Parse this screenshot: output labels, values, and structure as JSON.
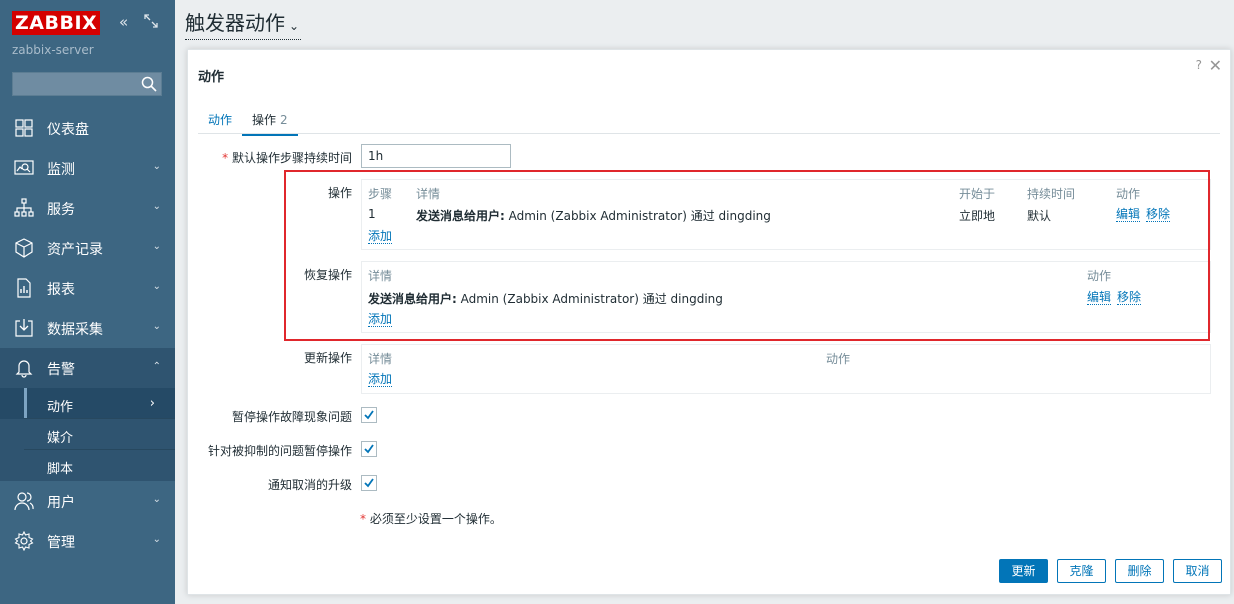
{
  "sidebar": {
    "logo": "ZABBIX",
    "server": "zabbix-server",
    "search_placeholder": "",
    "items": [
      {
        "label": "仪表盘",
        "icon": "dashboard-icon",
        "chevron": ""
      },
      {
        "label": "监测",
        "icon": "monitoring-icon",
        "chevron": "⌄"
      },
      {
        "label": "服务",
        "icon": "services-icon",
        "chevron": "⌄"
      },
      {
        "label": "资产记录",
        "icon": "inventory-icon",
        "chevron": "⌄"
      },
      {
        "label": "报表",
        "icon": "reports-icon",
        "chevron": "⌄"
      },
      {
        "label": "数据采集",
        "icon": "data-collection-icon",
        "chevron": "⌄"
      },
      {
        "label": "告警",
        "icon": "alerts-icon",
        "chevron": "⌃"
      },
      {
        "label": "用户",
        "icon": "users-icon",
        "chevron": "⌄"
      },
      {
        "label": "管理",
        "icon": "administration-icon",
        "chevron": "⌄"
      }
    ],
    "alerts_submenu": [
      {
        "label": "动作",
        "chevron": "›"
      },
      {
        "label": "媒介"
      },
      {
        "label": "脚本"
      }
    ]
  },
  "header": {
    "title": "触发器动作",
    "dropdown_glyph": "⌄"
  },
  "modal": {
    "title": "动作",
    "help": "?",
    "close": "✕",
    "tabs": [
      {
        "label": "动作"
      },
      {
        "label": "操作",
        "count": "2"
      }
    ],
    "default_duration": {
      "required_mark": "*",
      "label": "默认操作步骤持续时间",
      "value": "1h"
    },
    "operations": {
      "label": "操作",
      "headers": {
        "step": "步骤",
        "details": "详情",
        "start": "开始于",
        "duration": "持续时间",
        "action": "动作"
      },
      "rows": [
        {
          "step": "1",
          "details_bold": "发送消息给用户:",
          "details_rest": " Admin (Zabbix Administrator) 通过 dingding",
          "start": "立即地",
          "duration": "默认",
          "edit": "编辑",
          "remove": "移除"
        }
      ],
      "add": "添加"
    },
    "recovery": {
      "label": "恢复操作",
      "headers": {
        "details": "详情",
        "action": "动作"
      },
      "rows": [
        {
          "details_bold": "发送消息给用户:",
          "details_rest": " Admin (Zabbix Administrator) 通过 dingding",
          "edit": "编辑",
          "remove": "移除"
        }
      ],
      "add": "添加"
    },
    "update_ops": {
      "label": "更新操作",
      "headers": {
        "details": "详情",
        "action": "动作"
      },
      "add": "添加"
    },
    "checkboxes": [
      {
        "label": "暂停操作故障现象问题",
        "checked": true
      },
      {
        "label": "针对被抑制的问题暂停操作",
        "checked": true
      },
      {
        "label": "通知取消的升级",
        "checked": true
      }
    ],
    "footnote_mark": "*",
    "footnote": " 必须至少设置一个操作。",
    "buttons": {
      "update": "更新",
      "clone": "克隆",
      "delete": "删除",
      "cancel": "取消"
    }
  },
  "colors": {
    "sidebar": "#3d6682",
    "accent": "#0275b8",
    "logo": "#d40000",
    "highlight": "#e0272c"
  }
}
